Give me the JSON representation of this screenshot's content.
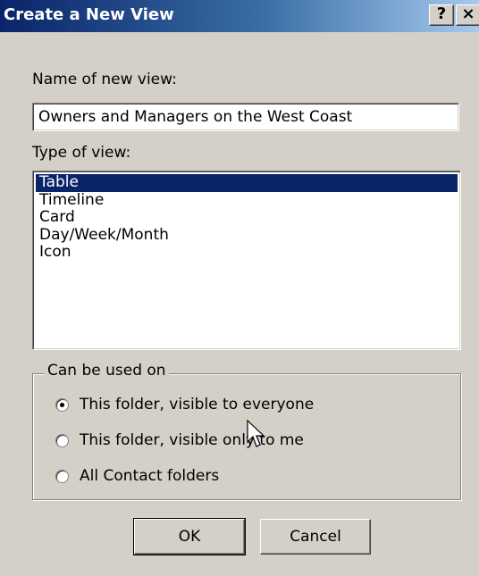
{
  "window": {
    "title": "Create a New View",
    "help_label": "?",
    "close_label": "×"
  },
  "name_field": {
    "label": "Name of new view:",
    "value": "Owners and Managers on the West Coast"
  },
  "type_list": {
    "label": "Type of view:",
    "items": [
      "Table",
      "Timeline",
      "Card",
      "Day/Week/Month",
      "Icon"
    ],
    "selected": "Table"
  },
  "usage_group": {
    "label": "Can be used on",
    "options": [
      {
        "label": "This folder, visible to everyone",
        "checked": true
      },
      {
        "label": "This folder, visible only to me",
        "checked": false
      },
      {
        "label": "All Contact folders",
        "checked": false
      }
    ]
  },
  "buttons": {
    "ok": "OK",
    "cancel": "Cancel"
  },
  "colors": {
    "title_start": "#0a246a",
    "title_end": "#a6caf0",
    "selection": "#0a246a",
    "face": "#d4d0c8"
  }
}
